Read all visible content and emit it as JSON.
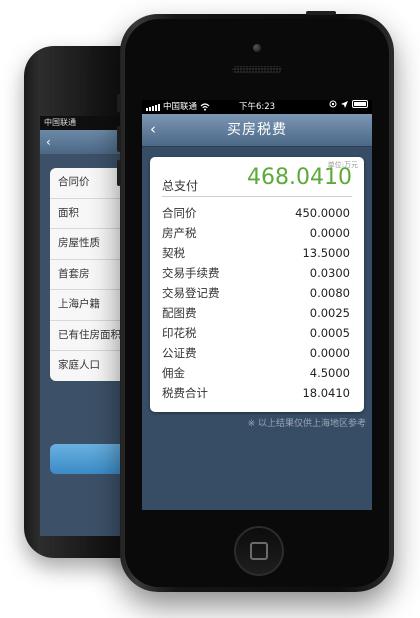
{
  "back_phone": {
    "status_carrier": "中国联通",
    "back_arrow": "‹",
    "list_items": [
      "合同价",
      "面积",
      "房屋性质",
      "首套房",
      "上海户籍",
      "已有住房面积",
      "家庭人口"
    ]
  },
  "status_bar": {
    "carrier": "中国联通",
    "time": "下午6:23"
  },
  "nav": {
    "back_arrow": "‹",
    "title": "买房税费"
  },
  "summary": {
    "unit": "单位:万元",
    "total_label": "总支付",
    "total_value": "468.0410"
  },
  "rows": [
    {
      "label": "合同价",
      "value": "450.0000"
    },
    {
      "label": "房产税",
      "value": "0.0000"
    },
    {
      "label": "契税",
      "value": "13.5000"
    },
    {
      "label": "交易手续费",
      "value": "0.0300"
    },
    {
      "label": "交易登记费",
      "value": "0.0080"
    },
    {
      "label": "配图费",
      "value": "0.0025"
    },
    {
      "label": "印花税",
      "value": "0.0005"
    },
    {
      "label": "公证费",
      "value": "0.0000"
    },
    {
      "label": "佣金",
      "value": "4.5000"
    },
    {
      "label": "税费合计",
      "value": "18.0410"
    }
  ],
  "footnote": "※ 以上结果仅供上海地区参考",
  "colors": {
    "total_value": "#5caa3a",
    "screen_bg": "#374c65",
    "nav_bar": "#5f7d9c"
  }
}
